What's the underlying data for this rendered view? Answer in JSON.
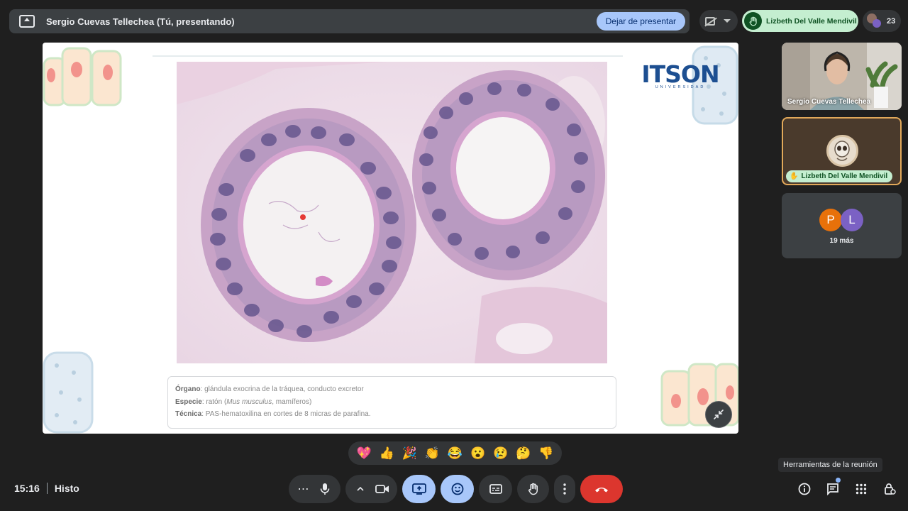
{
  "banner": {
    "title": "Sergio Cuevas Tellechea (Tú, presentando)",
    "stop_label": "Dejar de presentar"
  },
  "top_right": {
    "hand_raised_name": "Lizbeth Del Valle Mendivil",
    "participant_count": "23"
  },
  "slide": {
    "logo_text": "ITSON",
    "logo_subtext": "UNIVERSIDAD",
    "caption": {
      "organ_label": "Órgano",
      "organ_value": ": glándula exocrina de la tráquea, conducto excretor",
      "species_label": "Especie",
      "species_value_pre": ": ratón (",
      "species_italic": "Mus musculus",
      "species_value_post": ", mamíferos)",
      "technique_label": "Técnica",
      "technique_value": ": PAS-hematoxilina en cortes de 8 micras de parafina."
    }
  },
  "participants": {
    "tile1_name": "Sergio Cuevas Tellechea",
    "tile2_name": "Lizbeth Del Valle Mendivil",
    "tile3_avatar_p": "P",
    "tile3_avatar_l": "L",
    "tile3_more": "19 más"
  },
  "reactions": [
    "💖",
    "👍",
    "🎉",
    "👏",
    "😂",
    "😮",
    "😢",
    "🤔",
    "👎"
  ],
  "bottom": {
    "time": "15:16",
    "meeting_name": "Histo",
    "tooltip": "Herramientas de la reunión"
  },
  "colors": {
    "accent_blue": "#a8c7fa",
    "hangup_red": "#dc362e",
    "raised_hand_green": "#c4eed0",
    "logo_blue": "#1d4f91"
  }
}
